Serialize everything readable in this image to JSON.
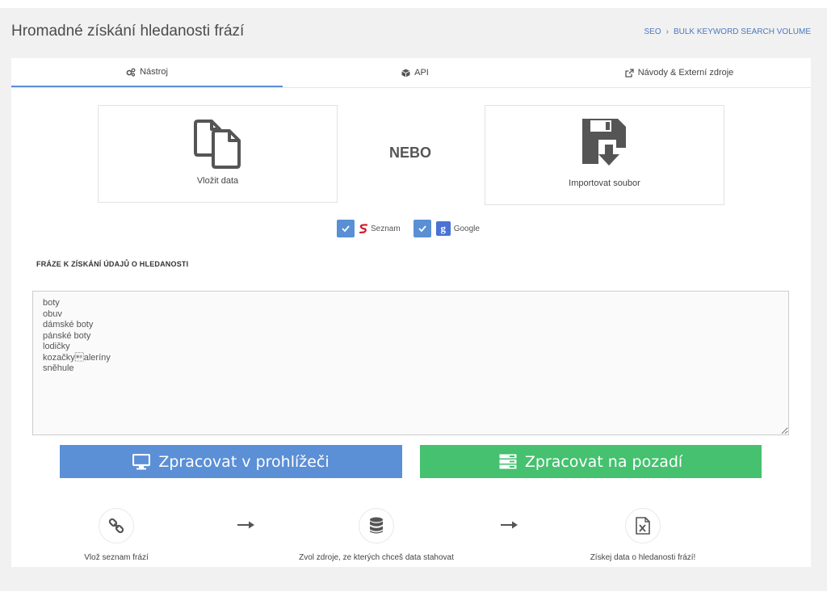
{
  "header": {
    "title": "Hromadné získání hledanosti frází",
    "breadcrumb": [
      "SEO",
      "BULK KEYWORD SEARCH VOLUME"
    ]
  },
  "tabs": [
    {
      "label": "Nástroj",
      "icon": "gears-icon",
      "active": true
    },
    {
      "label": "API",
      "icon": "cube-icon",
      "active": false
    },
    {
      "label": "Návody & Externí zdroje",
      "icon": "external-link-icon",
      "active": false
    }
  ],
  "input_options": {
    "paste_label": "Vložit data",
    "paste_icon": "copy-icon",
    "or_label": "NEBO",
    "import_label": "Importovat soubor",
    "import_icon": "save-import-icon"
  },
  "sources": [
    {
      "name": "Seznam",
      "checked": true,
      "icon": "seznam-logo-icon"
    },
    {
      "name": "Google",
      "checked": true,
      "icon": "google-plus-icon"
    }
  ],
  "phrases": {
    "label": "FRÁZE K ZÍSKÁNÍ ÚDAJŮ O HLEDANOSTI",
    "value": "boty\nobuv\ndámské boty\npánské boty\nlodičky\nkozačky\baleríny\nsněhule\n"
  },
  "actions": {
    "browser_label": "Zpracovat v prohlížeči",
    "browser_icon": "monitor-icon",
    "background_label": "Zpracovat na pozadí",
    "background_icon": "server-icon"
  },
  "steps": [
    {
      "label": "Vlož seznam frází",
      "icon": "link-icon"
    },
    {
      "label": "Zvol zdroje, ze kterých chceš data stahovat",
      "icon": "database-icon"
    },
    {
      "label": "Získej data o hledanosti frází!",
      "icon": "excel-file-icon"
    }
  ],
  "colors": {
    "primary": "#5b8fd6",
    "success": "#45c16f",
    "link": "#4a78c2"
  }
}
